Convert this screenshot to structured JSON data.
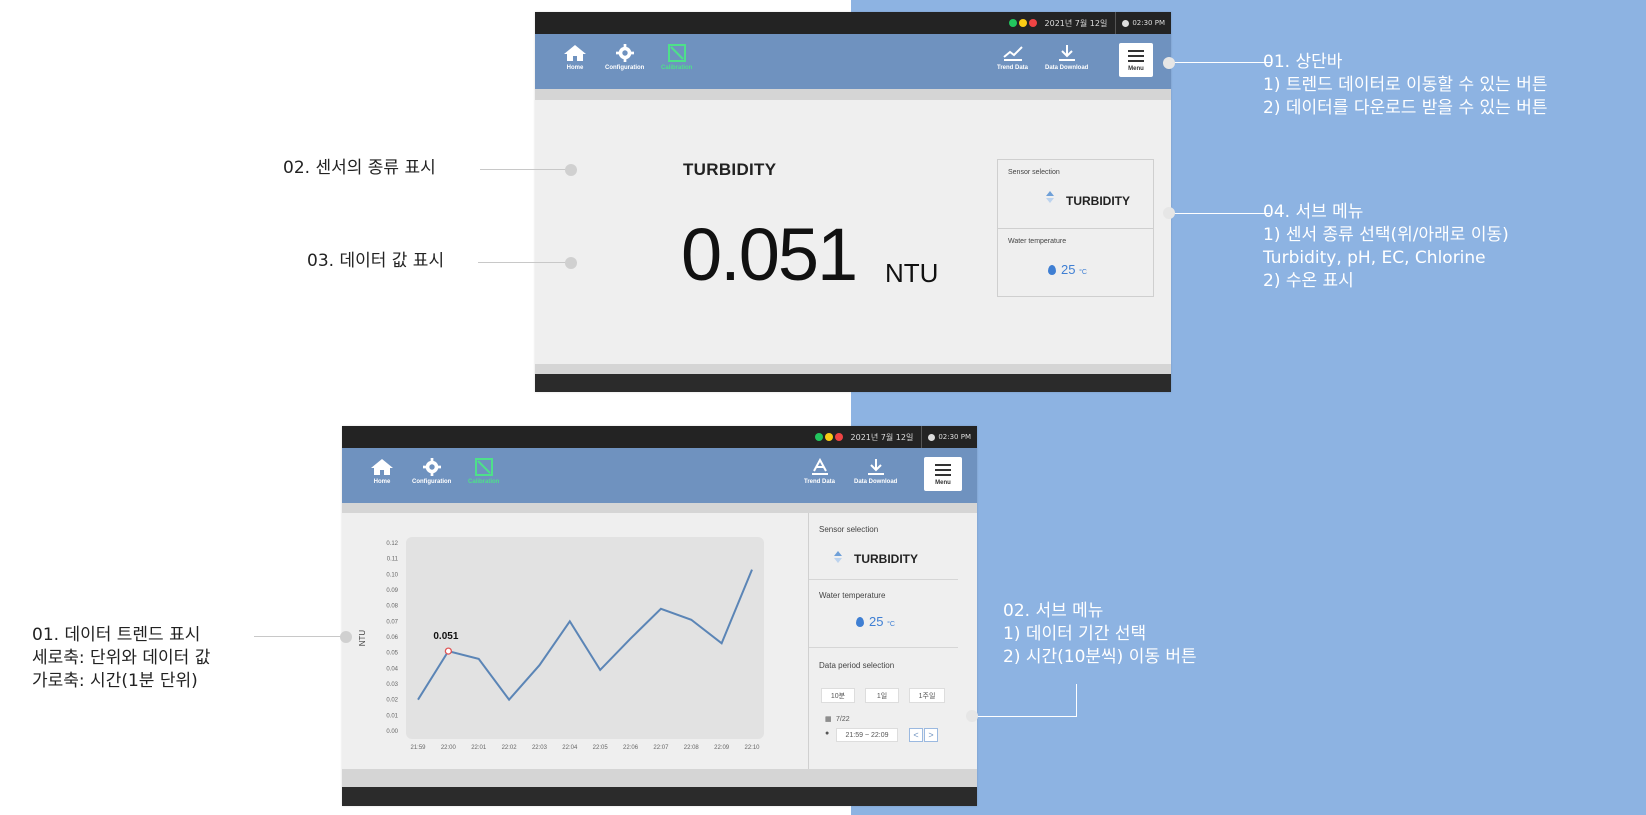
{
  "status": {
    "date": "2021년 7월 12일",
    "time": "02:30 PM",
    "leds": [
      "#22c55e",
      "#facc15",
      "#ef4444"
    ]
  },
  "nav": {
    "home": "Home",
    "configuration": "Configuration",
    "calibration": "Calibration",
    "trend_data": "Trend Data",
    "data_download": "Data Download",
    "menu": "Menu"
  },
  "main_screen": {
    "sensor_name": "TURBIDITY",
    "value": "0.051",
    "unit": "NTU",
    "sensor_selection_label": "Sensor selection",
    "sensor_selected": "TURBIDITY",
    "water_temp_label": "Water temperature",
    "water_temp_value": "25",
    "water_temp_unit": "°C"
  },
  "trend_screen": {
    "sensor_selection_label": "Sensor selection",
    "sensor_selected": "TURBIDITY",
    "water_temp_label": "Water temperature",
    "water_temp_value": "25",
    "water_temp_unit": "°C",
    "period_label": "Data period selection",
    "period_options": [
      "10분",
      "1일",
      "1주일"
    ],
    "date_value": "7/22",
    "time_range": "21:59 ~ 22:09",
    "prev": "<",
    "next": ">"
  },
  "chart_data": {
    "type": "line",
    "ylabel": "NTU",
    "ylim": [
      0,
      0.12
    ],
    "yticks": [
      "0.12",
      "0.11",
      "0.10",
      "0.09",
      "0.08",
      "0.07",
      "0.06",
      "0.05",
      "0.04",
      "0.03",
      "0.02",
      "0.01",
      "0.00"
    ],
    "categories": [
      "21:59",
      "22:00",
      "22:01",
      "22:02",
      "22:03",
      "22:04",
      "22:05",
      "22:06",
      "22:07",
      "22:08",
      "22:09",
      "22:10"
    ],
    "values": [
      0.02,
      0.051,
      0.046,
      0.02,
      0.042,
      0.07,
      0.039,
      0.059,
      0.078,
      0.071,
      0.056,
      0.103
    ],
    "highlight_label": "0.051",
    "grid": false
  },
  "annotations": {
    "top_1": [
      "01. 상단바",
      "1) 트렌드 데이터로 이동할 수 있는 버튼",
      "2) 데이터를 다운로드 받을 수 있는 버튼"
    ],
    "top_2": [
      "02. 센서의 종류 표시"
    ],
    "top_3": [
      "03. 데이터 값 표시"
    ],
    "top_4": [
      "04. 서브 메뉴",
      "1) 센서 종류 선택(위/아래로 이동)",
      "Turbidity, pH, EC, Chlorine",
      "2) 수온 표시"
    ],
    "bottom_1": [
      "01. 데이터 트렌드 표시",
      "세로축: 단위와 데이터 값",
      "가로축: 시간(1분 단위)"
    ],
    "bottom_2": [
      "02. 서브 메뉴",
      "1) 데이터 기간 선택",
      "2) 시간(10분씩) 이동 버튼"
    ]
  }
}
